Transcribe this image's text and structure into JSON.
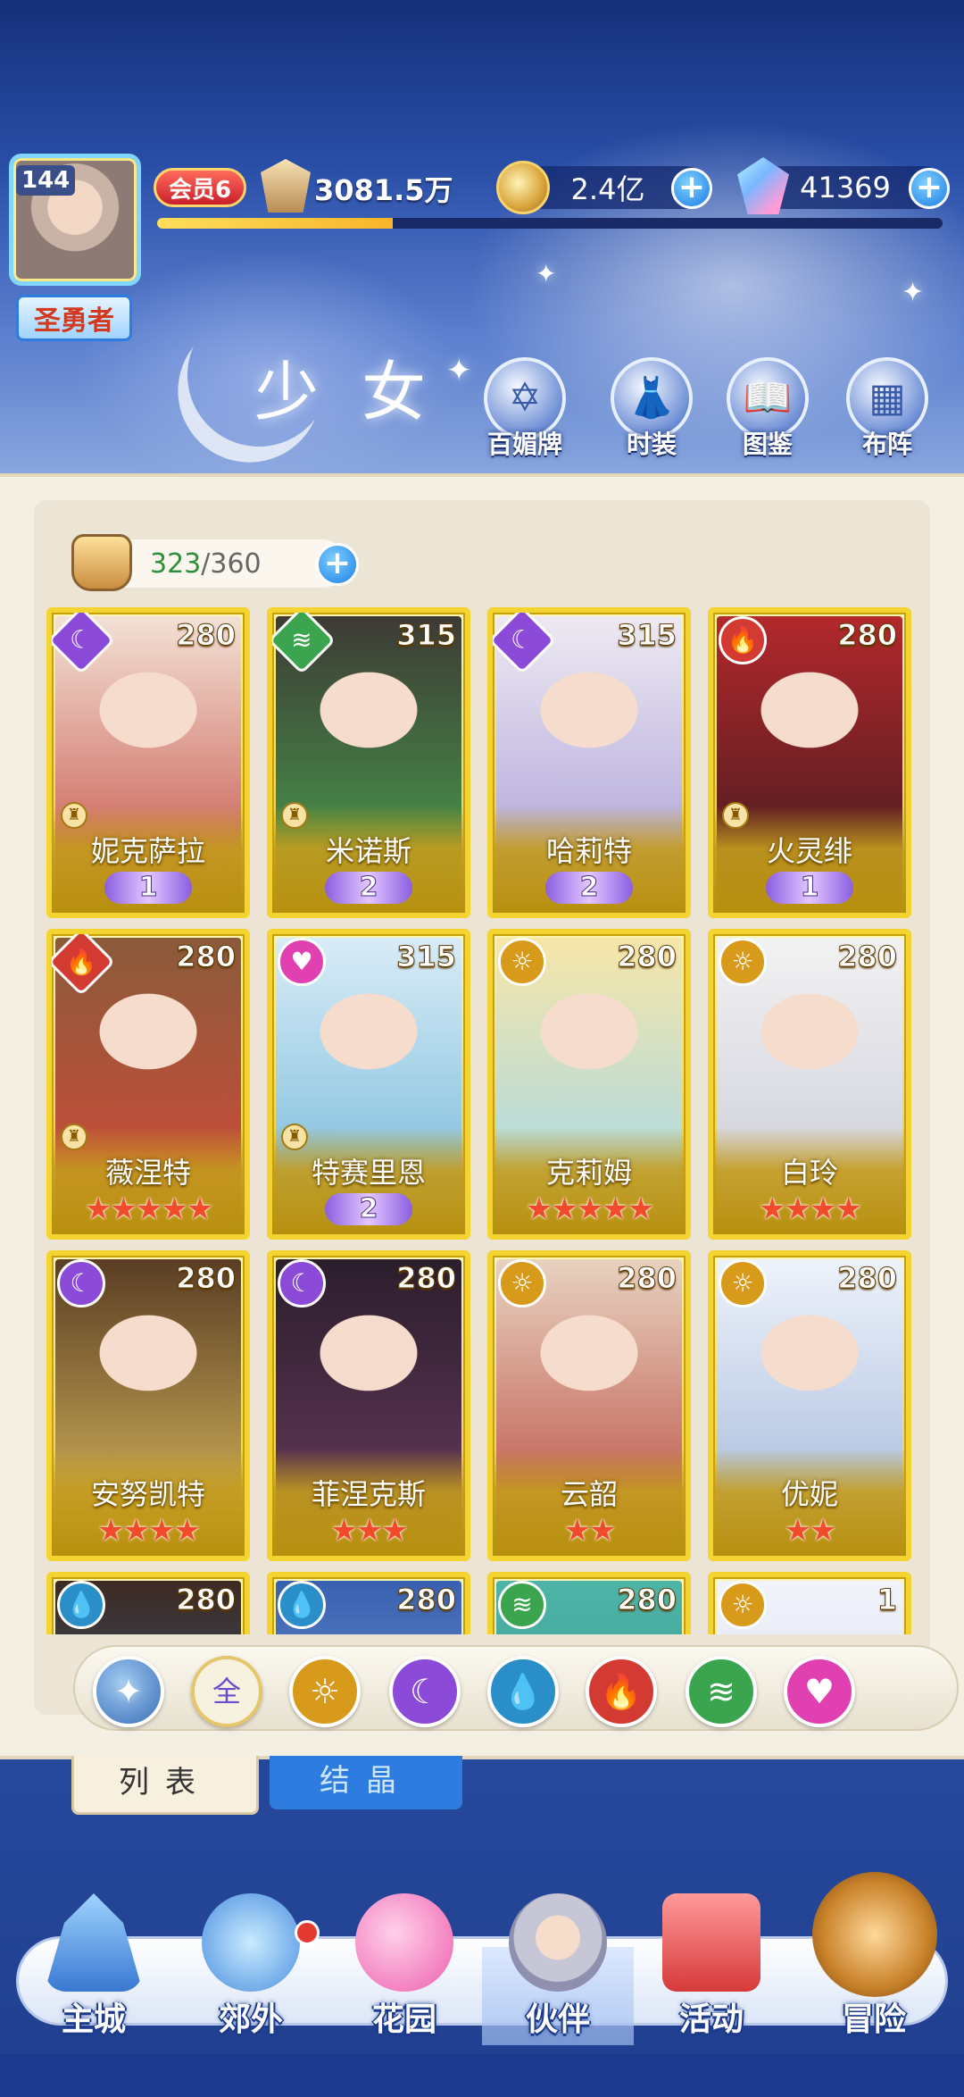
{
  "player": {
    "level": "144",
    "title": "圣勇者",
    "vip": "会员6",
    "power": "3081.5万",
    "exp_progress": 0.3
  },
  "currency": {
    "gold": "2.4亿",
    "gems": "41369"
  },
  "header": {
    "title": "少女",
    "nav": [
      {
        "label": "百媚牌",
        "icon": "card-deck-icon"
      },
      {
        "label": "时装",
        "icon": "outfit-icon"
      },
      {
        "label": "图鉴",
        "icon": "book-icon"
      },
      {
        "label": "布阵",
        "icon": "formation-grid-icon"
      }
    ]
  },
  "inventory": {
    "current": "323",
    "separator": "/",
    "max": "360"
  },
  "characters": [
    {
      "name": "妮克萨拉",
      "level": "280",
      "element": "moon",
      "awaken": "1",
      "stars": 0
    },
    {
      "name": "米诺斯",
      "level": "315",
      "element": "wind",
      "awaken": "2",
      "stars": 0
    },
    {
      "name": "哈莉特",
      "level": "315",
      "element": "moon",
      "awaken": "2",
      "stars": 0
    },
    {
      "name": "火灵绯",
      "level": "280",
      "element": "fire",
      "awaken": "1",
      "stars": 0
    },
    {
      "name": "薇涅特",
      "level": "280",
      "element": "fire",
      "awaken": "",
      "stars": 5
    },
    {
      "name": "特赛里恩",
      "level": "315",
      "element": "heart",
      "awaken": "2",
      "stars": 0
    },
    {
      "name": "克莉姆",
      "level": "280",
      "element": "sun",
      "awaken": "",
      "stars": 5
    },
    {
      "name": "白玲",
      "level": "280",
      "element": "sun",
      "awaken": "",
      "stars": 4
    },
    {
      "name": "安努凯特",
      "level": "280",
      "element": "moon",
      "awaken": "",
      "stars": 4
    },
    {
      "name": "菲涅克斯",
      "level": "280",
      "element": "moon",
      "awaken": "",
      "stars": 3
    },
    {
      "name": "云韶",
      "level": "280",
      "element": "sun",
      "awaken": "",
      "stars": 2
    },
    {
      "name": "优妮",
      "level": "280",
      "element": "sun",
      "awaken": "",
      "stars": 2
    },
    {
      "name": "",
      "level": "280",
      "element": "water",
      "awaken": "",
      "stars": 0
    },
    {
      "name": "",
      "level": "280",
      "element": "water",
      "awaken": "",
      "stars": 0
    },
    {
      "name": "",
      "level": "280",
      "element": "wind",
      "awaken": "",
      "stars": 0
    },
    {
      "name": "",
      "level": "1",
      "element": "sun",
      "awaken": "",
      "stars": 0
    }
  ],
  "filters": [
    {
      "label": "",
      "icon": "star-emblem-icon"
    },
    {
      "label": "全",
      "icon": "all-icon"
    },
    {
      "label": "",
      "icon": "sun-element-icon"
    },
    {
      "label": "",
      "icon": "moon-element-icon"
    },
    {
      "label": "",
      "icon": "water-element-icon"
    },
    {
      "label": "",
      "icon": "fire-element-icon"
    },
    {
      "label": "",
      "icon": "wind-element-icon"
    },
    {
      "label": "",
      "icon": "heart-element-icon"
    }
  ],
  "tabs": {
    "list": "列表",
    "crystal": "结晶"
  },
  "bottom_nav": [
    {
      "label": "主城",
      "icon": "castle-icon"
    },
    {
      "label": "郊外",
      "icon": "hexagram-icon"
    },
    {
      "label": "花园",
      "icon": "hearts-icon"
    },
    {
      "label": "伙伴",
      "icon": "partner-avatar-icon"
    },
    {
      "label": "活动",
      "icon": "gift-box-icon"
    },
    {
      "label": "冒险",
      "icon": "compass-icon"
    }
  ],
  "colors": {
    "card_gold": "#f4d431",
    "accent_blue": "#1e7de6",
    "star_red": "#f24a2d"
  }
}
